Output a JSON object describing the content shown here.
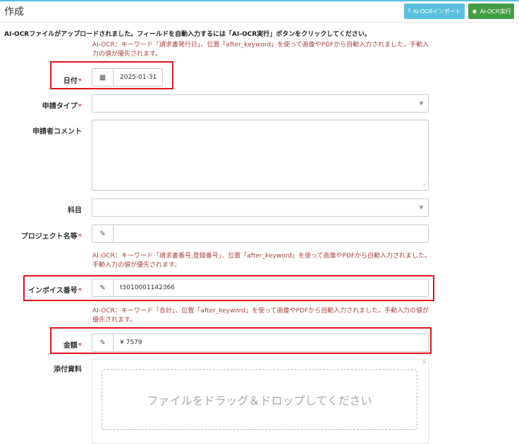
{
  "header": {
    "title": "作成",
    "import_button": "AI-OCRインポート",
    "run_button": "AI-OCR実行"
  },
  "notice": "AI-OCRファイルがアップロードされました。フィールドを自動入力するには「AI-OCR実行」ボタンをクリックしてください。",
  "hints": {
    "date": "AI-OCR：キーワード「請求書発行日」、位置「after_keyword」を使って画像やPDFから自動入力されました。手動入力の値が優先されます。",
    "invoice": "AI-OCR：キーワード「請求書番号,登録番号」、位置「after_keyword」を使って画像やPDFから自動入力されました。手動入力の値が優先されます。",
    "amount": "AI-OCR：キーワード「合計」、位置「after_keyword」を使って画像やPDFから自動入力されました。手動入力の値が優先されます。"
  },
  "fields": {
    "date": {
      "label": "日付",
      "required": "*",
      "value": "2025-01-31"
    },
    "application_type": {
      "label": "申請タイプ",
      "required": "*",
      "value": ""
    },
    "comment": {
      "label": "申請者コメント",
      "value": ""
    },
    "subject": {
      "label": "科目",
      "value": ""
    },
    "project": {
      "label": "プロジェクト名等",
      "required": "*",
      "value": ""
    },
    "invoice": {
      "label": "インボイス番号",
      "required": "*",
      "value": "t3010001142366"
    },
    "amount": {
      "label": "金額",
      "required": "*",
      "value": "¥ 7579"
    },
    "attachment": {
      "label": "添付資料",
      "dropzone_text": "ファイルをドラッグ＆ドロップしてください"
    }
  },
  "icons": {
    "calendar": "calendar-icon",
    "pencil": "pencil-icon",
    "upload": "upload-icon",
    "robot": "robot-icon"
  },
  "colors": {
    "accent_info": "#5bc0de",
    "accent_success": "#449d44",
    "required": "#d9534f",
    "hint": "#a94442",
    "highlight": "#e0141e"
  }
}
